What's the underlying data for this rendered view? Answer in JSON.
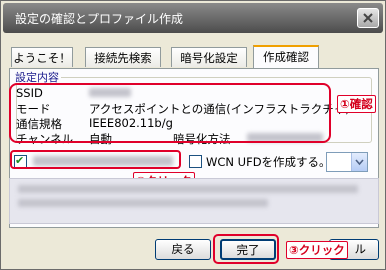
{
  "window": {
    "title": "設定の確認とプロファイル作成"
  },
  "tabs": [
    {
      "label": "ようこそ！"
    },
    {
      "label": "接続先検索"
    },
    {
      "label": "暗号化設定"
    },
    {
      "label": "作成確認"
    }
  ],
  "active_tab": "作成確認",
  "settings": {
    "group_title": "設定内容",
    "ssid_label": "SSID",
    "mode_label": "モード",
    "mode_value": "アクセスポイントとの通信(インフラストラクチャ)",
    "standard_label": "通信規格",
    "standard_value": "IEEE802.11b/g",
    "channel_label": "チャンネル",
    "channel_value": "自動",
    "encryption_label": "暗号化方法"
  },
  "options": {
    "profile_check_mark": "✔",
    "wcn_label": "WCN UFDを作成する。"
  },
  "buttons": {
    "back": "戻る",
    "finish": "完了",
    "cancel": "ル"
  },
  "callouts": {
    "confirm": "①確認",
    "click1": "②クリック",
    "click2": "③クリック"
  },
  "colors": {
    "callout": "#e0002a",
    "tab_highlight": "#f0a000"
  }
}
